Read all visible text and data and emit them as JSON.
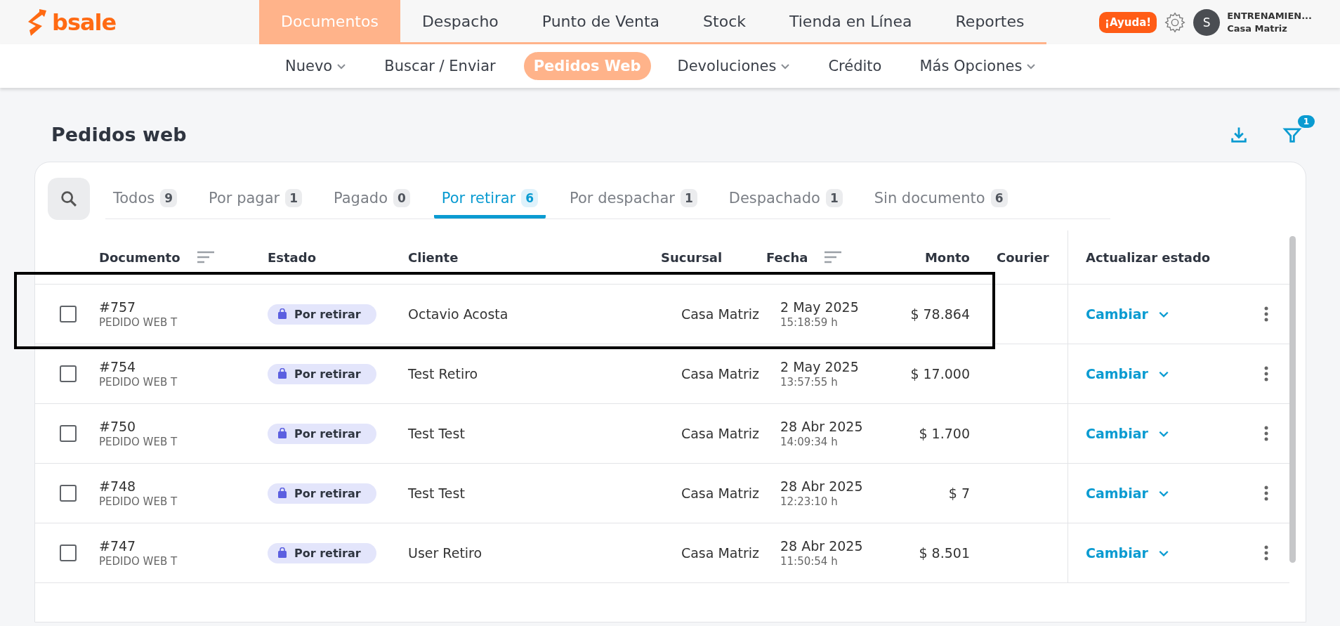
{
  "brand": {
    "name": "bsale"
  },
  "main_nav": [
    {
      "label": "Documentos",
      "selected": true
    },
    {
      "label": "Despacho",
      "selected": false
    },
    {
      "label": "Punto de Venta",
      "selected": false
    },
    {
      "label": "Stock",
      "selected": false
    },
    {
      "label": "Tienda en Línea",
      "selected": false
    },
    {
      "label": "Reportes",
      "selected": false
    }
  ],
  "help_button": "¡Ayuda!",
  "user": {
    "initial": "S",
    "name": "ENTRENAMIEN...",
    "branch": "Casa Matriz"
  },
  "sub_nav": [
    {
      "label": "Nuevo",
      "dropdown": true,
      "selected": false
    },
    {
      "label": "Buscar / Enviar",
      "dropdown": false,
      "selected": false
    },
    {
      "label": "Pedidos Web",
      "dropdown": false,
      "selected": true
    },
    {
      "label": "Devoluciones",
      "dropdown": true,
      "selected": false
    },
    {
      "label": "Crédito",
      "dropdown": false,
      "selected": false
    },
    {
      "label": "Más Opciones",
      "dropdown": true,
      "selected": false
    }
  ],
  "page_title": "Pedidos web",
  "filter_badge": "1",
  "tabs": [
    {
      "label": "Todos",
      "count": "9",
      "selected": false
    },
    {
      "label": "Por pagar",
      "count": "1",
      "selected": false
    },
    {
      "label": "Pagado",
      "count": "0",
      "selected": false
    },
    {
      "label": "Por retirar",
      "count": "6",
      "selected": true
    },
    {
      "label": "Por despachar",
      "count": "1",
      "selected": false
    },
    {
      "label": "Despachado",
      "count": "1",
      "selected": false
    },
    {
      "label": "Sin documento",
      "count": "6",
      "selected": false
    }
  ],
  "table": {
    "columns": [
      {
        "label": "Documento",
        "sortable": true
      },
      {
        "label": "Estado",
        "sortable": false
      },
      {
        "label": "Cliente",
        "sortable": false
      },
      {
        "label": "Sucursal",
        "sortable": false
      },
      {
        "label": "Fecha",
        "sortable": true
      },
      {
        "label": "Monto",
        "sortable": false
      },
      {
        "label": "Courier",
        "sortable": false
      }
    ],
    "action_column": "Actualizar estado",
    "rows": [
      {
        "number": "#757",
        "type": "PEDIDO WEB T",
        "status": "Por retirar",
        "client": "Octavio Acosta",
        "branch": "Casa Matriz",
        "date": "2 May 2025",
        "time": "15:18:59 h",
        "amount": "$ 78.864",
        "action": "Cambiar",
        "checked": false,
        "highlighted": true
      },
      {
        "number": "#754",
        "type": "PEDIDO WEB T",
        "status": "Por retirar",
        "client": "Test Retiro",
        "branch": "Casa Matriz",
        "date": "2 May 2025",
        "time": "13:57:55 h",
        "amount": "$ 17.000",
        "action": "Cambiar",
        "checked": false,
        "highlighted": false
      },
      {
        "number": "#750",
        "type": "PEDIDO WEB T",
        "status": "Por retirar",
        "client": "Test Test",
        "branch": "Casa Matriz",
        "date": "28 Abr 2025",
        "time": "14:09:34 h",
        "amount": "$ 1.700",
        "action": "Cambiar",
        "checked": false,
        "highlighted": false
      },
      {
        "number": "#748",
        "type": "PEDIDO WEB T",
        "status": "Por retirar",
        "client": "Test Test",
        "branch": "Casa Matriz",
        "date": "28 Abr 2025",
        "time": "12:23:10 h",
        "amount": "$ 7",
        "action": "Cambiar",
        "checked": false,
        "highlighted": false
      },
      {
        "number": "#747",
        "type": "PEDIDO WEB T",
        "status": "Por retirar",
        "client": "User Retiro",
        "branch": "Casa Matriz",
        "date": "28 Abr 2025",
        "time": "11:50:54 h",
        "amount": "$ 8.501",
        "action": "Cambiar",
        "checked": false,
        "highlighted": false
      }
    ]
  }
}
